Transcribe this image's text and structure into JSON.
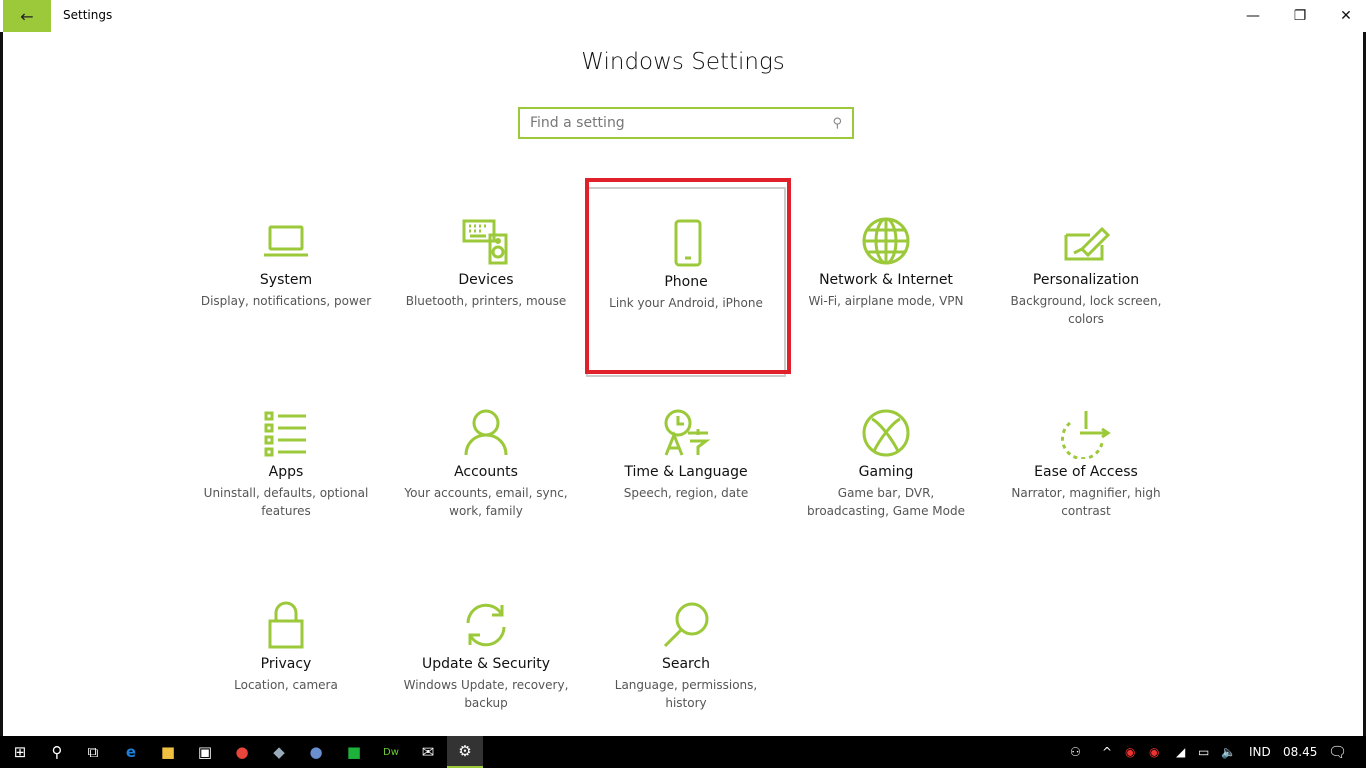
{
  "window": {
    "title": "Settings",
    "back_icon": "arrow-left-icon",
    "minimize": "—",
    "restore": "❐",
    "close": "✕"
  },
  "accent": "#9bc93a",
  "heading": "Windows Settings",
  "search": {
    "placeholder": "Find a setting",
    "icon": "search-icon"
  },
  "tiles": [
    {
      "title": "System",
      "desc": "Display, notifications, power",
      "icon": "laptop-icon"
    },
    {
      "title": "Devices",
      "desc": "Bluetooth, printers, mouse",
      "icon": "keyboard-speaker-icon"
    },
    {
      "title": "Phone",
      "desc": "Link your Android, iPhone",
      "icon": "phone-icon"
    },
    {
      "title": "Network & Internet",
      "desc": "Wi-Fi, airplane mode, VPN",
      "icon": "globe-icon"
    },
    {
      "title": "Personalization",
      "desc": "Background, lock screen, colors",
      "icon": "paint-icon"
    },
    {
      "title": "Apps",
      "desc": "Uninstall, defaults, optional features",
      "icon": "list-icon"
    },
    {
      "title": "Accounts",
      "desc": "Your accounts, email, sync, work, family",
      "icon": "person-icon"
    },
    {
      "title": "Time & Language",
      "desc": "Speech, region, date",
      "icon": "time-language-icon"
    },
    {
      "title": "Gaming",
      "desc": "Game bar, DVR, broadcasting, Game Mode",
      "icon": "xbox-icon"
    },
    {
      "title": "Ease of Access",
      "desc": "Narrator, magnifier, high contrast",
      "icon": "ease-of-access-icon"
    },
    {
      "title": "Privacy",
      "desc": "Location, camera",
      "icon": "lock-icon"
    },
    {
      "title": "Update & Security",
      "desc": "Windows Update, recovery, backup",
      "icon": "refresh-icon"
    },
    {
      "title": "Search",
      "desc": "Language, permissions, history",
      "icon": "magnifier-icon"
    }
  ],
  "taskbar": {
    "language": "IND",
    "time": "08.45"
  }
}
